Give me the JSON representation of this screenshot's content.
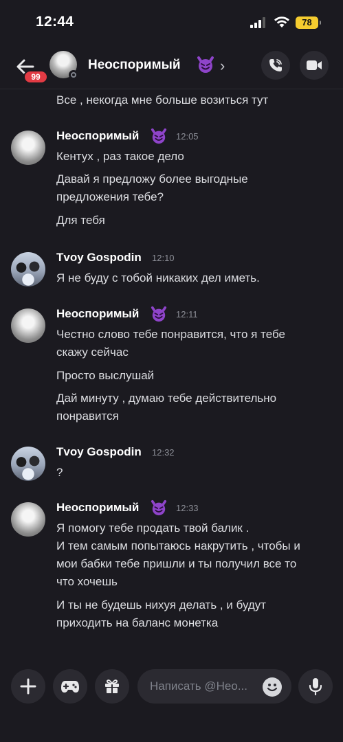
{
  "status_bar": {
    "time": "12:44",
    "battery": "78"
  },
  "header": {
    "back_badge": "99",
    "title": "Неоспоримый",
    "title_emoji": "smiling-imp",
    "chevron": "›"
  },
  "messages": {
    "top_line": "Все , некогда мне больше возиться тут",
    "groups": [
      {
        "author": "Неоспоримый",
        "time": "12:05",
        "lines": [
          "Кентух , раз такое дело",
          "Давай я предложу более выгодные",
          "предложения тебе?",
          "Для тебя"
        ]
      },
      {
        "author": "Tvoy Gospodin",
        "time": "12:10",
        "lines": [
          "Я не буду с тобой никаких дел иметь."
        ]
      },
      {
        "author": "Неоспоримый",
        "time": "12:11",
        "lines": [
          "Честно слово тебе понравится, что я тебе",
          "скажу сейчас",
          "Просто выслушай",
          "Дай минуту , думаю тебе действительно",
          "понравится"
        ]
      },
      {
        "author": "Tvoy Gospodin",
        "time": "12:32",
        "lines": [
          "?"
        ]
      },
      {
        "author": "Неоспоримый",
        "time": "12:33",
        "lines": [
          "Я помогу тебе продать твой балик .",
          "И тем самым попытаюсь накрутить , чтобы и",
          "мои бабки тебе пришли и ты получил все то",
          "что хочешь",
          "И ты не будешь нихуя делать , и будут",
          "приходить на баланс монетка"
        ]
      }
    ]
  },
  "composer": {
    "placeholder": "Написать @Нео..."
  },
  "colors": {
    "background": "#1b1a20",
    "badge": "#e23b44",
    "battery": "#f5cc2f",
    "emoji": "#8e44c9"
  }
}
